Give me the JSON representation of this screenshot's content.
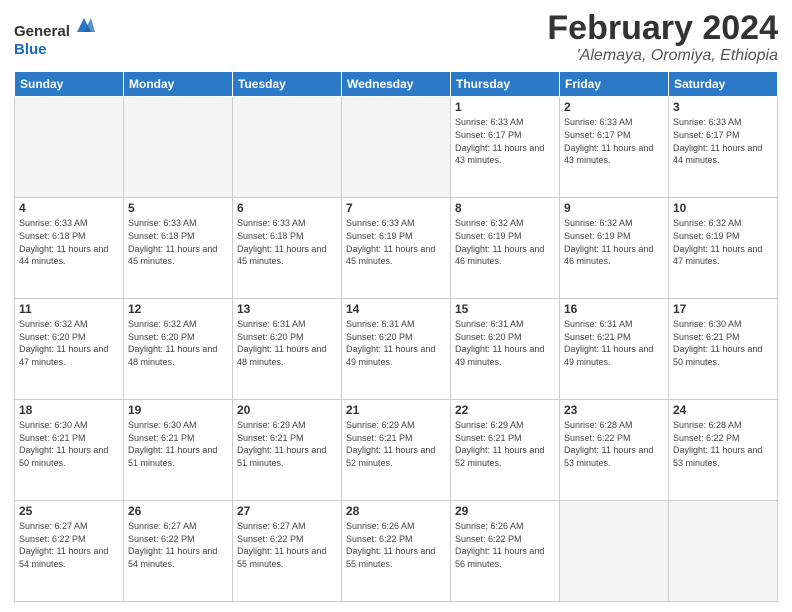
{
  "header": {
    "logo_general": "General",
    "logo_blue": "Blue",
    "title": "February 2024",
    "location": "'Alemaya, Oromiya, Ethiopia"
  },
  "weekdays": [
    "Sunday",
    "Monday",
    "Tuesday",
    "Wednesday",
    "Thursday",
    "Friday",
    "Saturday"
  ],
  "weeks": [
    [
      {
        "day": "",
        "info": ""
      },
      {
        "day": "",
        "info": ""
      },
      {
        "day": "",
        "info": ""
      },
      {
        "day": "",
        "info": ""
      },
      {
        "day": "1",
        "info": "Sunrise: 6:33 AM\nSunset: 6:17 PM\nDaylight: 11 hours\nand 43 minutes."
      },
      {
        "day": "2",
        "info": "Sunrise: 6:33 AM\nSunset: 6:17 PM\nDaylight: 11 hours\nand 43 minutes."
      },
      {
        "day": "3",
        "info": "Sunrise: 6:33 AM\nSunset: 6:17 PM\nDaylight: 11 hours\nand 44 minutes."
      }
    ],
    [
      {
        "day": "4",
        "info": "Sunrise: 6:33 AM\nSunset: 6:18 PM\nDaylight: 11 hours\nand 44 minutes."
      },
      {
        "day": "5",
        "info": "Sunrise: 6:33 AM\nSunset: 6:18 PM\nDaylight: 11 hours\nand 45 minutes."
      },
      {
        "day": "6",
        "info": "Sunrise: 6:33 AM\nSunset: 6:18 PM\nDaylight: 11 hours\nand 45 minutes."
      },
      {
        "day": "7",
        "info": "Sunrise: 6:33 AM\nSunset: 6:19 PM\nDaylight: 11 hours\nand 45 minutes."
      },
      {
        "day": "8",
        "info": "Sunrise: 6:32 AM\nSunset: 6:19 PM\nDaylight: 11 hours\nand 46 minutes."
      },
      {
        "day": "9",
        "info": "Sunrise: 6:32 AM\nSunset: 6:19 PM\nDaylight: 11 hours\nand 46 minutes."
      },
      {
        "day": "10",
        "info": "Sunrise: 6:32 AM\nSunset: 6:19 PM\nDaylight: 11 hours\nand 47 minutes."
      }
    ],
    [
      {
        "day": "11",
        "info": "Sunrise: 6:32 AM\nSunset: 6:20 PM\nDaylight: 11 hours\nand 47 minutes."
      },
      {
        "day": "12",
        "info": "Sunrise: 6:32 AM\nSunset: 6:20 PM\nDaylight: 11 hours\nand 48 minutes."
      },
      {
        "day": "13",
        "info": "Sunrise: 6:31 AM\nSunset: 6:20 PM\nDaylight: 11 hours\nand 48 minutes."
      },
      {
        "day": "14",
        "info": "Sunrise: 6:31 AM\nSunset: 6:20 PM\nDaylight: 11 hours\nand 49 minutes."
      },
      {
        "day": "15",
        "info": "Sunrise: 6:31 AM\nSunset: 6:20 PM\nDaylight: 11 hours\nand 49 minutes."
      },
      {
        "day": "16",
        "info": "Sunrise: 6:31 AM\nSunset: 6:21 PM\nDaylight: 11 hours\nand 49 minutes."
      },
      {
        "day": "17",
        "info": "Sunrise: 6:30 AM\nSunset: 6:21 PM\nDaylight: 11 hours\nand 50 minutes."
      }
    ],
    [
      {
        "day": "18",
        "info": "Sunrise: 6:30 AM\nSunset: 6:21 PM\nDaylight: 11 hours\nand 50 minutes."
      },
      {
        "day": "19",
        "info": "Sunrise: 6:30 AM\nSunset: 6:21 PM\nDaylight: 11 hours\nand 51 minutes."
      },
      {
        "day": "20",
        "info": "Sunrise: 6:29 AM\nSunset: 6:21 PM\nDaylight: 11 hours\nand 51 minutes."
      },
      {
        "day": "21",
        "info": "Sunrise: 6:29 AM\nSunset: 6:21 PM\nDaylight: 11 hours\nand 52 minutes."
      },
      {
        "day": "22",
        "info": "Sunrise: 6:29 AM\nSunset: 6:21 PM\nDaylight: 11 hours\nand 52 minutes."
      },
      {
        "day": "23",
        "info": "Sunrise: 6:28 AM\nSunset: 6:22 PM\nDaylight: 11 hours\nand 53 minutes."
      },
      {
        "day": "24",
        "info": "Sunrise: 6:28 AM\nSunset: 6:22 PM\nDaylight: 11 hours\nand 53 minutes."
      }
    ],
    [
      {
        "day": "25",
        "info": "Sunrise: 6:27 AM\nSunset: 6:22 PM\nDaylight: 11 hours\nand 54 minutes."
      },
      {
        "day": "26",
        "info": "Sunrise: 6:27 AM\nSunset: 6:22 PM\nDaylight: 11 hours\nand 54 minutes."
      },
      {
        "day": "27",
        "info": "Sunrise: 6:27 AM\nSunset: 6:22 PM\nDaylight: 11 hours\nand 55 minutes."
      },
      {
        "day": "28",
        "info": "Sunrise: 6:26 AM\nSunset: 6:22 PM\nDaylight: 11 hours\nand 55 minutes."
      },
      {
        "day": "29",
        "info": "Sunrise: 6:26 AM\nSunset: 6:22 PM\nDaylight: 11 hours\nand 56 minutes."
      },
      {
        "day": "",
        "info": ""
      },
      {
        "day": "",
        "info": ""
      }
    ]
  ]
}
